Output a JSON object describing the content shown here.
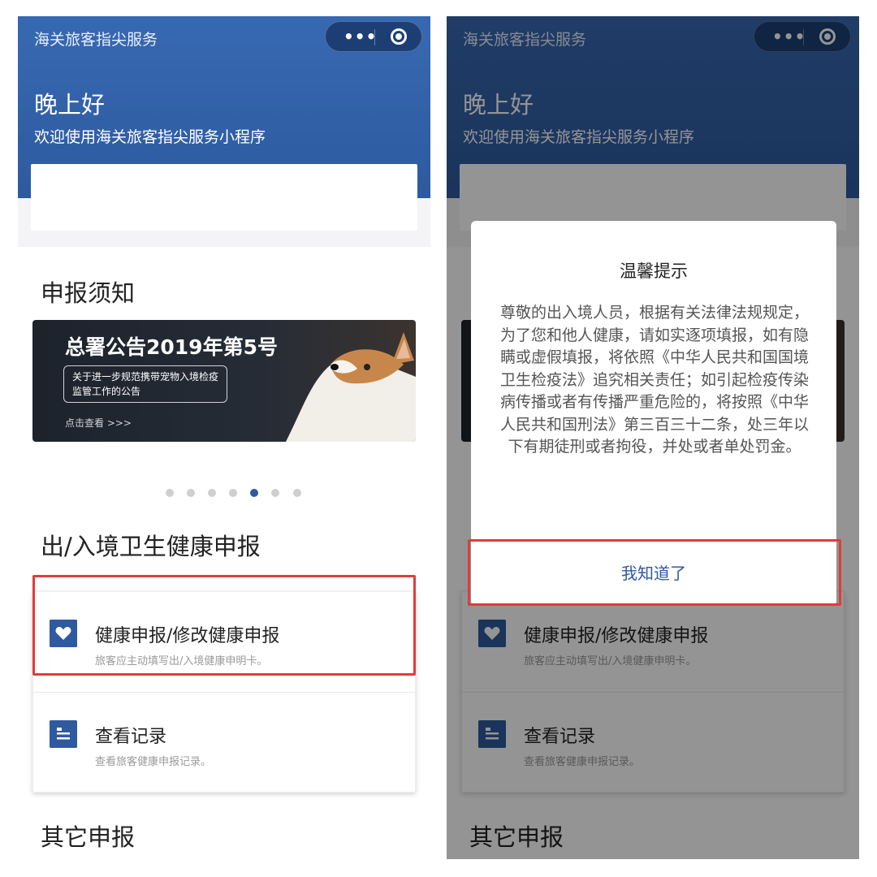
{
  "screen": {
    "nav_title": "海关旅客指尖服务",
    "greeting": "晚上好",
    "welcome": "欢迎使用海关旅客指尖服务小程序",
    "notice_section": "申报须知",
    "banner": {
      "title": "总署公告2019年第5号",
      "subtitle": "关于进一步规范携带宠物入境检疫监管工作的公告",
      "link": "点击查看 >>>"
    },
    "carousel": {
      "count": 7,
      "active": 5
    },
    "health_section": "出/入境卫生健康申报",
    "items": [
      {
        "title": "健康申报/修改健康申报",
        "desc": "旅客应主动填写出/入境健康申明卡。",
        "icon": "heart-icon"
      },
      {
        "title": "查看记录",
        "desc": "查看旅客健康申报记录。",
        "icon": "record-icon"
      }
    ],
    "other_section": "其它申报"
  },
  "dialog": {
    "title": "温馨提示",
    "body": "尊敬的出入境人员，根据有关法律法规规定，为了您和他人健康，请如实逐项填报，如有隐瞒或虚假填报，将依照《中华人民共和国国境卫生检疫法》追究相关责任；如引起检疫传染病传播或者有传播严重危险的，将按照《中华人民共和国刑法》第三百三十二条，处三年以下有期徒刑或者拘役，并处或者单处罚金。",
    "button": "我知道了"
  },
  "colors": {
    "brand": "#2e5a9f",
    "highlight": "#e23b3b"
  }
}
